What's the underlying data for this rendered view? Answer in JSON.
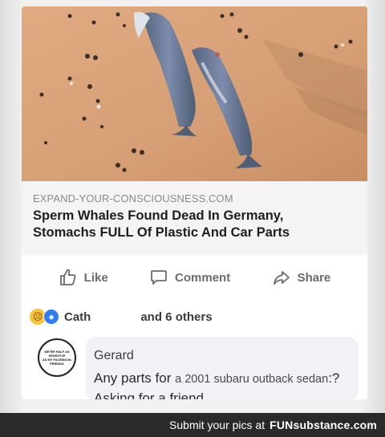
{
  "post": {
    "link_domain": "EXPAND-YOUR-CONSCIOUSNESS.COM",
    "link_title_line1": "Sperm Whales Found Dead In Germany,",
    "link_title_line2": "Stomachs FULL Of Plastic And Car Parts",
    "image_alt": "two whales on beach with people"
  },
  "actions": {
    "like_label": "Like",
    "comment_label": "Comment",
    "share_label": "Share"
  },
  "reactions": {
    "name": "Cath",
    "others": "and 6 others"
  },
  "comment": {
    "author": "Gerard",
    "text_part1": "Any parts for ",
    "text_small": "a 2001 subaru outback sedan",
    "text_part2": ":? Asking for a friend.",
    "avatar_text": [
      "WE'RE HALF AS",
      "SENSITIVE",
      "AS MY FACEBOOK",
      "FRIENDS"
    ]
  },
  "footer": {
    "text": "Submit your pics at",
    "brand": "FUNsubstance.com"
  },
  "colors": {
    "sand": "#d9a27a",
    "whale": "#6d7f9b",
    "footer_bg": "#2a2a2a",
    "link_bg": "#f4f4f4"
  }
}
